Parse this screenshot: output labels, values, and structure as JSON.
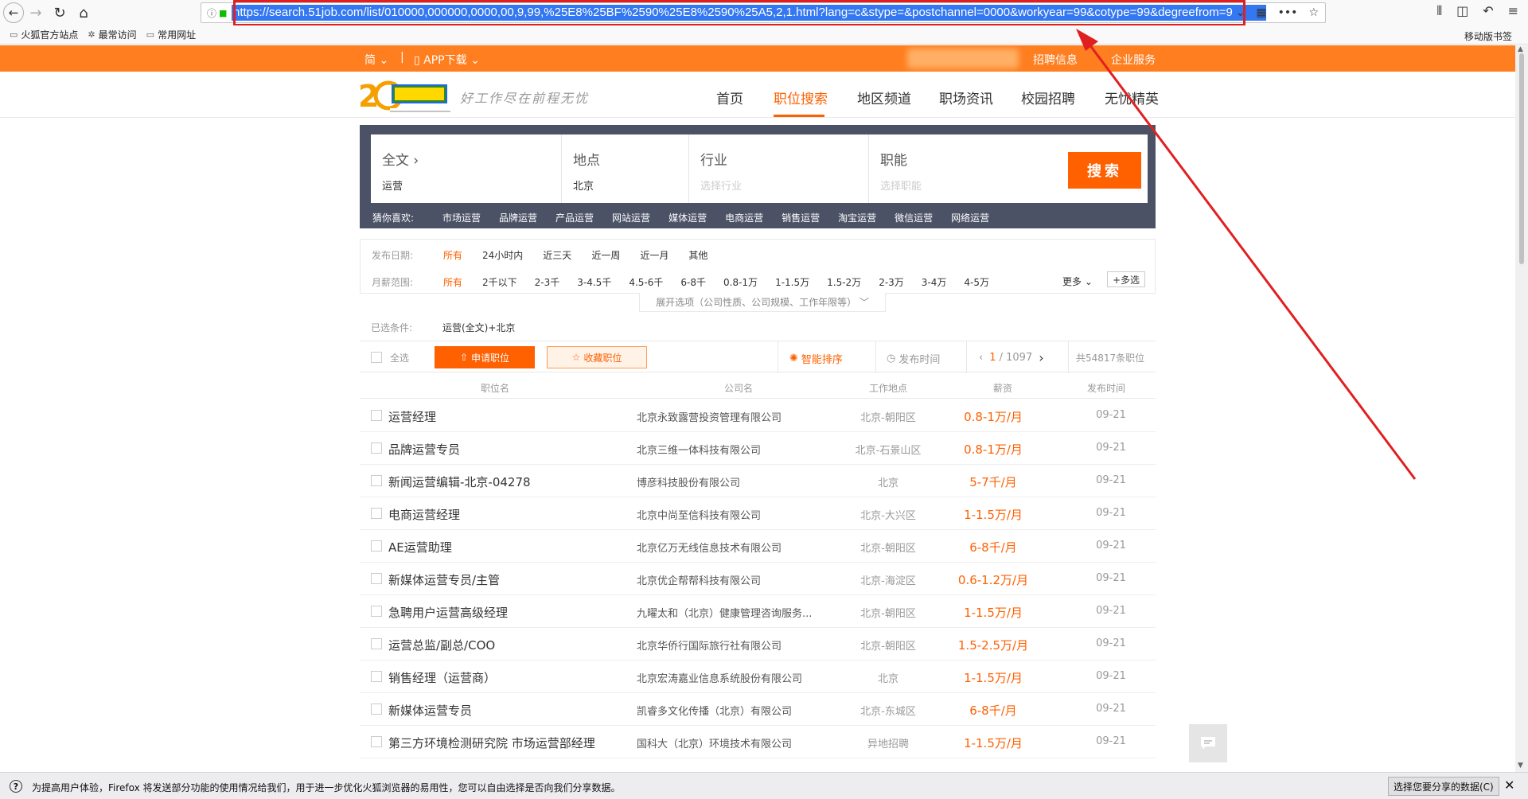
{
  "browser": {
    "url": "https://search.51job.com/list/010000,000000,0000,00,9,99,%25E8%25BF%2590%25E8%2590%25A5,2,1.html?lang=c&stype=&postchannel=0000&workyear=99&cotype=99&degreefrom=9",
    "bookmarks": [
      "火狐官方站点",
      "最常访问",
      "常用网址"
    ],
    "mobile_bookmarks": "移动版书签"
  },
  "topbar": {
    "lang": "简 ⌄",
    "separator": "|",
    "app": "▯ APP下载 ⌄",
    "recruit": "招聘信息",
    "enterprise": "企业服务"
  },
  "header": {
    "slogan": "好工作尽在前程无忧",
    "nav": [
      "首页",
      "职位搜索",
      "地区频道",
      "职场资讯",
      "校园招聘",
      "无忧精英"
    ]
  },
  "search": {
    "fields": [
      {
        "label": "全文",
        "value": "运营",
        "placeholder": ""
      },
      {
        "label": "地点",
        "value": "北京",
        "placeholder": ""
      },
      {
        "label": "行业",
        "value": "",
        "placeholder": "选择行业"
      },
      {
        "label": "职能",
        "value": "",
        "placeholder": "选择职能"
      }
    ],
    "button": "搜索",
    "guess_label": "猜你喜欢:",
    "guess": [
      "市场运营",
      "品牌运营",
      "产品运营",
      "网站运营",
      "媒体运营",
      "电商运营",
      "销售运营",
      "淘宝运营",
      "微信运营",
      "网络运营"
    ]
  },
  "filters": {
    "date_label": "发布日期:",
    "date_options": [
      "所有",
      "24小时内",
      "近三天",
      "近一周",
      "近一月",
      "其他"
    ],
    "salary_label": "月薪范围:",
    "salary_options": [
      "所有",
      "2千以下",
      "2-3千",
      "3-4.5千",
      "4.5-6千",
      "6-8千",
      "0.8-1万",
      "1-1.5万",
      "1.5-2万",
      "2-3万",
      "3-4万",
      "4-5万"
    ],
    "more": "更多 ⌄",
    "multi": "+多选",
    "expand": "展开选项（公司性质、公司规模、工作年限等） ﹀",
    "selected_label": "已选条件:",
    "selected_value": "运营(全文)+北京"
  },
  "actions": {
    "select_all": "全选",
    "apply": "申请职位",
    "favorite": "收藏职位",
    "smart_sort": "智能排序",
    "time_sort": "发布时间",
    "page_current": "1",
    "page_total": "/ 1097",
    "total_jobs": "共54817条职位"
  },
  "table": {
    "headers": [
      "职位名",
      "公司名",
      "工作地点",
      "薪资",
      "发布时间"
    ],
    "rows": [
      {
        "title": "运营经理",
        "company": "北京永致露营投资管理有限公司",
        "loc": "北京-朝阳区",
        "salary": "0.8-1万/月",
        "date": "09-21"
      },
      {
        "title": "品牌运营专员",
        "company": "北京三维一体科技有限公司",
        "loc": "北京-石景山区",
        "salary": "0.8-1万/月",
        "date": "09-21"
      },
      {
        "title": "新闻运营编辑-北京-04278",
        "company": "博彦科技股份有限公司",
        "loc": "北京",
        "salary": "5-7千/月",
        "date": "09-21"
      },
      {
        "title": "电商运营经理",
        "company": "北京中尚至信科技有限公司",
        "loc": "北京-大兴区",
        "salary": "1-1.5万/月",
        "date": "09-21"
      },
      {
        "title": "AE运营助理",
        "company": "北京亿万无线信息技术有限公司",
        "loc": "北京-朝阳区",
        "salary": "6-8千/月",
        "date": "09-21"
      },
      {
        "title": "新媒体运营专员/主管",
        "company": "北京优企帮帮科技有限公司",
        "loc": "北京-海淀区",
        "salary": "0.6-1.2万/月",
        "date": "09-21"
      },
      {
        "title": "急聘用户运营高级经理",
        "company": "九曜太和（北京）健康管理咨询服务...",
        "loc": "北京-朝阳区",
        "salary": "1-1.5万/月",
        "date": "09-21"
      },
      {
        "title": "运营总监/副总/COO",
        "company": "北京华侨行国际旅行社有限公司",
        "loc": "北京-朝阳区",
        "salary": "1.5-2.5万/月",
        "date": "09-21"
      },
      {
        "title": "销售经理（运营商）",
        "company": "北京宏涛嘉业信息系统股份有限公司",
        "loc": "北京",
        "salary": "1-1.5万/月",
        "date": "09-21"
      },
      {
        "title": "新媒体运营专员",
        "company": "凯睿多文化传播（北京）有限公司",
        "loc": "北京-东城区",
        "salary": "6-8千/月",
        "date": "09-21"
      },
      {
        "title": "第三方环境检测研究院 市场运营部经理",
        "company": "国科大（北京）环境技术有限公司",
        "loc": "异地招聘",
        "salary": "1-1.5万/月",
        "date": "09-21"
      }
    ]
  },
  "notification": {
    "text": "为提高用户体验，Firefox 将发送部分功能的使用情况给我们，用于进一步优化火狐浏览器的易用性，您可以自由选择是否向我们分享数据。",
    "button": "选择您要分享的数据(C)",
    "close": "✕"
  },
  "colors": {
    "accent": "#ff6000",
    "topbar": "#ff7e1f",
    "search_panel": "#4b5266",
    "annotation": "#e02020"
  }
}
